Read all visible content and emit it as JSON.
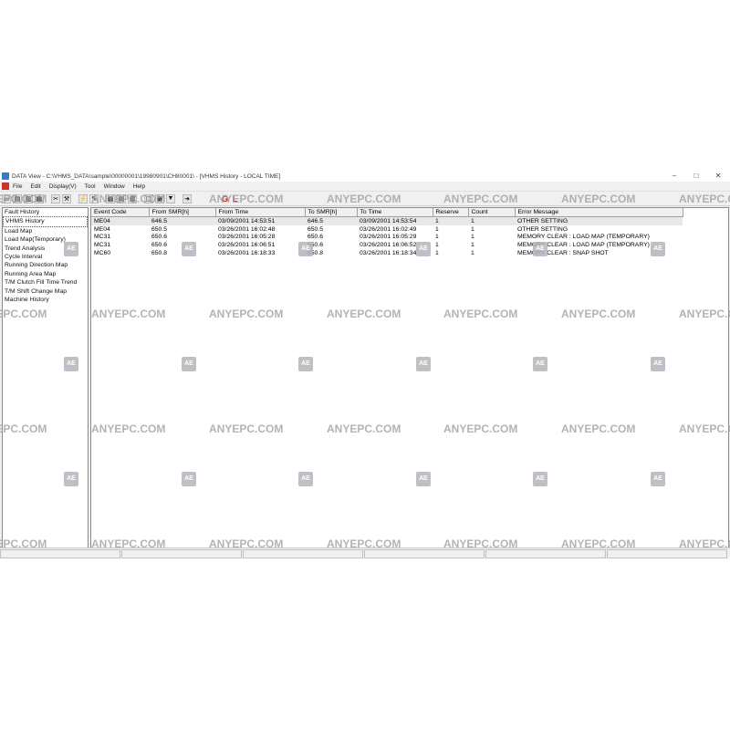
{
  "window": {
    "title": "DATA View - C:\\VHMS_DATA\\sample\\00000001\\19980901\\CH80001\\ - [VHMS History - LOCAL TIME]",
    "minimize": "–",
    "maximize": "□",
    "close": "✕"
  },
  "menu": [
    "File",
    "Edit",
    "Display(V)",
    "Tool",
    "Window",
    "Help"
  ],
  "toolbar": {
    "g_label": "G",
    "l_label": "L"
  },
  "nav": {
    "items": [
      "Fault History",
      "VHMS History",
      "Load Map",
      "Load Map(Temporary)",
      "Trend Analysis",
      "Cycle Interval",
      "Running Direction Map",
      "Running Area Map",
      "T/M Clutch Fill Time Trend",
      "T/M Shift Change Map",
      "Machine History"
    ],
    "selected_index": 1
  },
  "grid": {
    "columns": [
      "Event Code",
      "From SMR[h]",
      "From Time",
      "To SMR[h]",
      "To Time",
      "Reserve",
      "Count",
      "Error Message"
    ],
    "rows": [
      [
        "ME04",
        "646.5",
        "03/09/2001 14:53:51",
        "646.5",
        "03/09/2001 14:53:54",
        "1",
        "1",
        "OTHER SETTING"
      ],
      [
        "ME04",
        "650.5",
        "03/26/2001 16:02:48",
        "650.5",
        "03/26/2001 16:02:49",
        "1",
        "1",
        "OTHER SETTING"
      ],
      [
        "MC31",
        "650.6",
        "03/26/2001 16:05:28",
        "650.6",
        "03/26/2001 16:05:29",
        "1",
        "1",
        "MEMORY CLEAR : LOAD MAP (TEMPORARY)"
      ],
      [
        "MC31",
        "650.6",
        "03/26/2001 16:06:51",
        "650.6",
        "03/26/2001 16:06:52",
        "1",
        "1",
        "MEMORY CLEAR : LOAD MAP (TEMPORARY)"
      ],
      [
        "MC60",
        "650.8",
        "03/26/2001 16:18:33",
        "650.8",
        "03/26/2001 16:18:34",
        "1",
        "1",
        "MEMORY CLEAR : SNAP SHOT"
      ]
    ]
  },
  "watermark": {
    "text": "ANYEPC.COM",
    "badge": "AE"
  }
}
